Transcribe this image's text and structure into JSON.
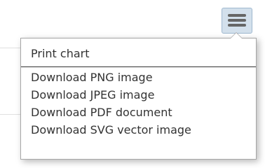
{
  "icons": {
    "menu_button": "hamburger-menu-icon"
  },
  "colors": {
    "button_bg": "#d3e0ec",
    "icon": "#666666",
    "text": "#333333",
    "border": "#a6a6a6"
  },
  "menu": {
    "items": [
      {
        "label": "Print chart"
      },
      {
        "label": "Download PNG image"
      },
      {
        "label": "Download JPEG image"
      },
      {
        "label": "Download PDF document"
      },
      {
        "label": "Download SVG vector image"
      }
    ]
  }
}
